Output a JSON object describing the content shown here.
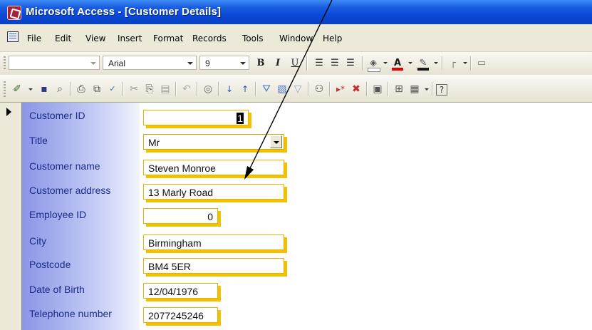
{
  "window": {
    "title": "Microsoft Access - [Customer Details]",
    "icon": "access-app-icon"
  },
  "menu": {
    "icon": "form-document-icon",
    "items": [
      "File",
      "Edit",
      "View",
      "Insert",
      "Format",
      "Records",
      "Tools",
      "Window",
      "Help"
    ]
  },
  "format_toolbar": {
    "object_combo": "",
    "font_combo": "Arial",
    "size_combo": "9",
    "buttons": [
      "B",
      "I",
      "U"
    ]
  },
  "record": {
    "fields": [
      {
        "label": "Customer ID",
        "value": "1"
      },
      {
        "label": "Title",
        "value": "Mr"
      },
      {
        "label": "Customer name",
        "value": "Steven Monroe"
      },
      {
        "label": "Customer address",
        "value": "13 Marly Road"
      },
      {
        "label": "Employee ID",
        "value": "0"
      },
      {
        "label": "City",
        "value": "Birmingham"
      },
      {
        "label": "Postcode",
        "value": "BM4 5ER"
      },
      {
        "label": "Date of Birth",
        "value": "12/04/1976"
      },
      {
        "label": "Telephone number",
        "value": "2077245246"
      }
    ]
  },
  "colors": {
    "title_bar": "#0a4ad8",
    "field_shadow": "#f2c200",
    "label_text": "#1c2c88",
    "label_gradient": "#8a96e6"
  }
}
